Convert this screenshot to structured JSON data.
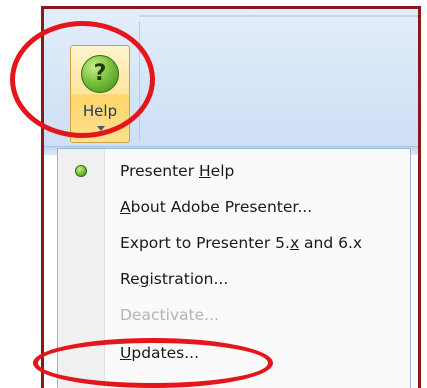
{
  "ribbon": {
    "help_button": {
      "label": "Help",
      "icon": "question-circle-icon",
      "icon_glyph": "?"
    }
  },
  "menu": {
    "items": [
      {
        "pre": "Presenter ",
        "accel": "H",
        "post": "elp",
        "enabled": true,
        "icon": "help-icon"
      },
      {
        "pre": "",
        "accel": "A",
        "post": "bout Adobe Presenter...",
        "enabled": true
      },
      {
        "pre": "Export to Presenter 5.",
        "accel": "x",
        "post": " and 6.x",
        "enabled": true
      },
      {
        "pre": "Re",
        "accel": "g",
        "post": "istration...",
        "enabled": true
      },
      {
        "pre": "Deactivate...",
        "accel": "",
        "post": "",
        "enabled": false
      },
      {
        "pre": "",
        "accel": "U",
        "post": "pdates...",
        "enabled": true
      }
    ]
  },
  "annotation_color": "#e4151b"
}
